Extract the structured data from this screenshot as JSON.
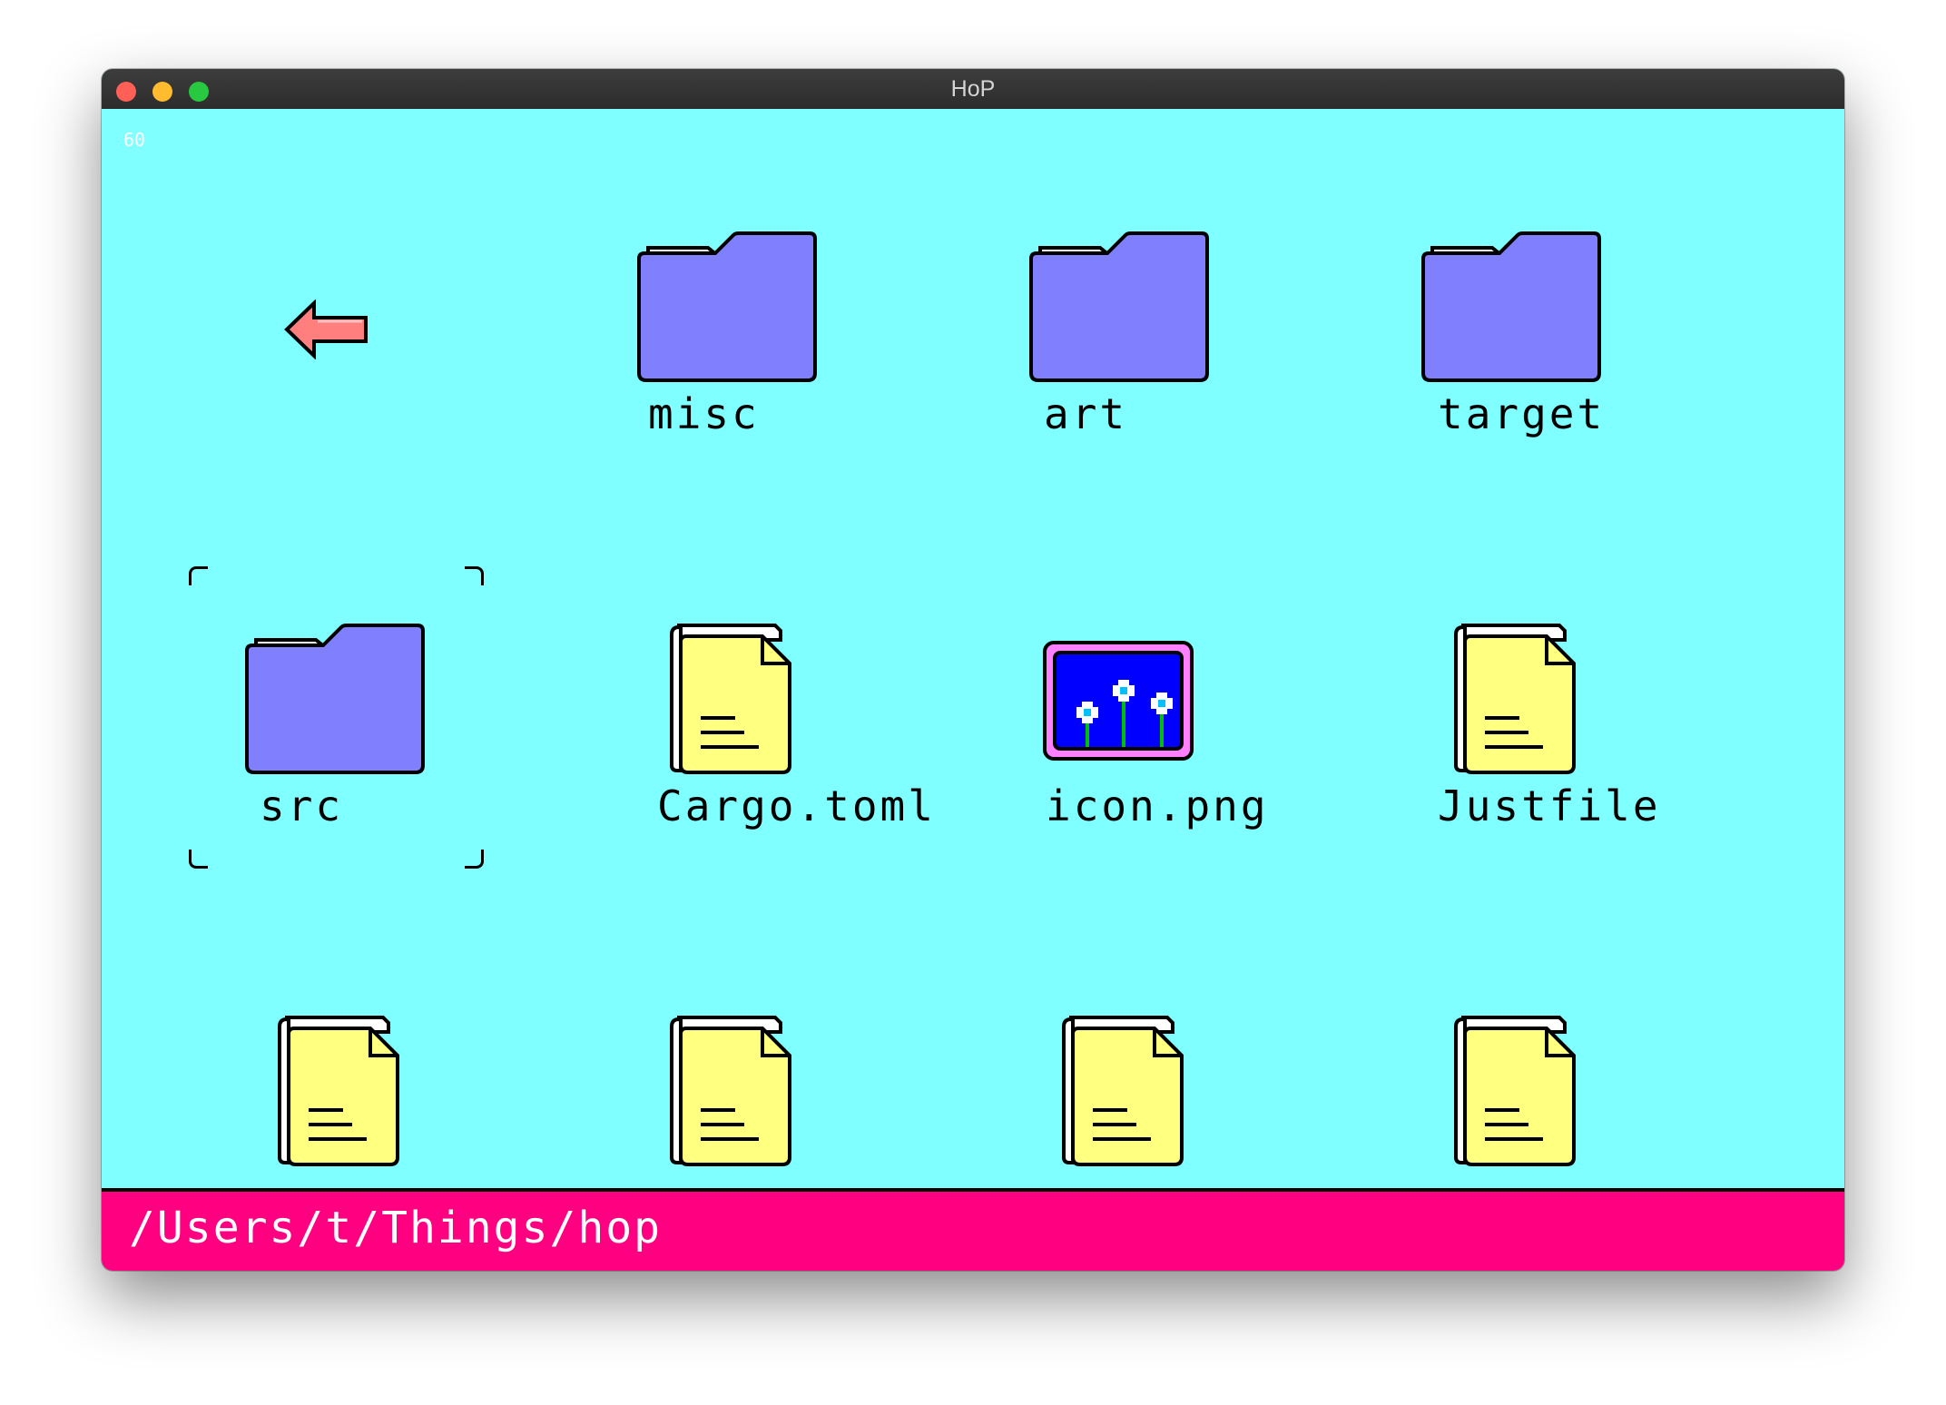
{
  "window": {
    "title": "HoP"
  },
  "fps_counter": "60",
  "colors": {
    "background": "#7fffff",
    "folder": "#8080ff",
    "file": "#ffff80",
    "status_bar": "#ff0080",
    "back_arrow": "#ff7f7f"
  },
  "entries": [
    {
      "name": "misc",
      "type": "folder"
    },
    {
      "name": "art",
      "type": "folder"
    },
    {
      "name": "target",
      "type": "folder"
    },
    {
      "name": "src",
      "type": "folder",
      "selected": true
    },
    {
      "name": "Cargo.toml",
      "type": "file"
    },
    {
      "name": "icon.png",
      "type": "image"
    },
    {
      "name": "Justfile",
      "type": "file"
    },
    {
      "name": "",
      "type": "file"
    },
    {
      "name": "",
      "type": "file"
    },
    {
      "name": "",
      "type": "file"
    },
    {
      "name": "",
      "type": "file"
    }
  ],
  "status_bar": {
    "path": "/Users/t/Things/hop"
  }
}
